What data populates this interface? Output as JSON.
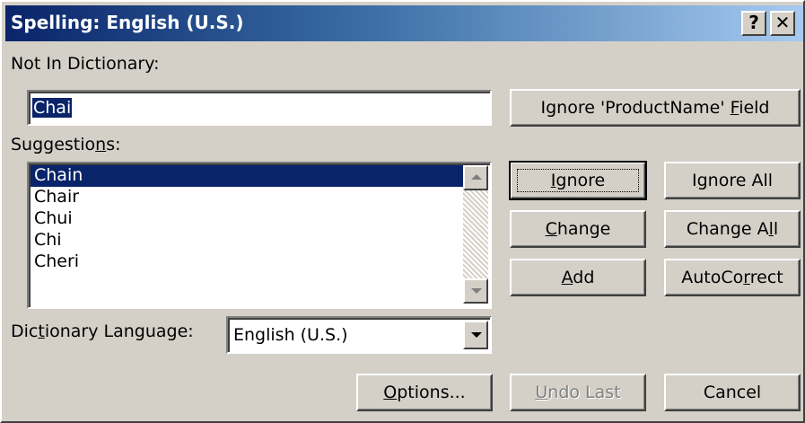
{
  "titlebar": {
    "title": "Spelling: English (U.S.)",
    "help_glyph": "?",
    "close_glyph": "✕"
  },
  "not_in_dictionary": {
    "label": "Not In Dictionary:",
    "value": "Chai"
  },
  "suggestions": {
    "label_pre": "Suggestio",
    "label_u": "n",
    "label_post": "s:",
    "items": [
      "Chain",
      "Chair",
      "Chui",
      "Chi",
      "Cheri"
    ],
    "selected_index": 0
  },
  "dictionary_language": {
    "label_pre": "Dic",
    "label_u": "t",
    "label_post": "ionary Language:",
    "value": "English (U.S.)"
  },
  "buttons": {
    "ignore_field": {
      "pre": "Ignore 'ProductName' ",
      "u": "F",
      "post": "ield"
    },
    "ignore": {
      "pre": "",
      "u": "I",
      "post": "gnore"
    },
    "ignore_all": {
      "pre": "I",
      "u": "g",
      "post": "nore All"
    },
    "change": {
      "pre": "",
      "u": "C",
      "post": "hange"
    },
    "change_all": {
      "pre": "Change A",
      "u": "l",
      "post": "l"
    },
    "add": {
      "pre": "",
      "u": "A",
      "post": "dd"
    },
    "autocorrect": {
      "pre": "AutoCo",
      "u": "r",
      "post": "rect"
    },
    "options": {
      "pre": "",
      "u": "O",
      "post": "ptions..."
    },
    "undo_last": {
      "pre": "",
      "u": "U",
      "post": "ndo Last"
    },
    "cancel": {
      "pre": "Cancel",
      "u": "",
      "post": ""
    }
  },
  "colors": {
    "title_gradient_start": "#0a246a",
    "title_gradient_end": "#a6caf0",
    "face": "#d4d0c8",
    "selection": "#0a246a"
  }
}
